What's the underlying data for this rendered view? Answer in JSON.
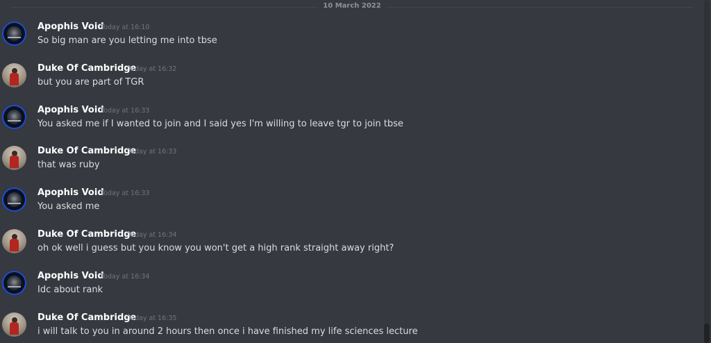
{
  "date_divider": "10 March 2022",
  "messages": [
    {
      "author": "Apophis Void",
      "time": "Today at 16:10",
      "text": "So big man are you letting me into tbse",
      "avatar_icon": "blue-ring-avatar"
    },
    {
      "author": "Duke Of Cambridge",
      "time": "Today at 16:32",
      "text": "but you are part of TGR",
      "avatar_icon": "guard-photo-avatar"
    },
    {
      "author": "Apophis Void",
      "time": "Today at 16:33",
      "text": "You asked me if I wanted to join and I said yes I'm willing to leave tgr to join tbse",
      "avatar_icon": "blue-ring-avatar"
    },
    {
      "author": "Duke Of Cambridge",
      "time": "Today at 16:33",
      "text": "that was ruby",
      "avatar_icon": "guard-photo-avatar"
    },
    {
      "author": "Apophis Void",
      "time": "Today at 16:33",
      "text": "You asked me",
      "avatar_icon": "blue-ring-avatar"
    },
    {
      "author": "Duke Of Cambridge",
      "time": "Today at 16:34",
      "text": "oh ok well i guess but you know you won't get a high rank straight away right?",
      "avatar_icon": "guard-photo-avatar"
    },
    {
      "author": "Apophis Void",
      "time": "Today at 16:34",
      "text": "Idc about rank",
      "avatar_icon": "blue-ring-avatar"
    },
    {
      "author": "Duke Of Cambridge",
      "time": "Today at 16:35",
      "text": "i will talk to you in around 2 hours then once i have finished my life sciences lecture",
      "avatar_icon": "guard-photo-avatar"
    }
  ],
  "colors": {
    "background": "#36393f",
    "username": "#ffffff",
    "message_text": "#dcddde",
    "timestamp": "#72767d",
    "divider": "#42454a",
    "avatar_ring": "#1f4fd8"
  }
}
